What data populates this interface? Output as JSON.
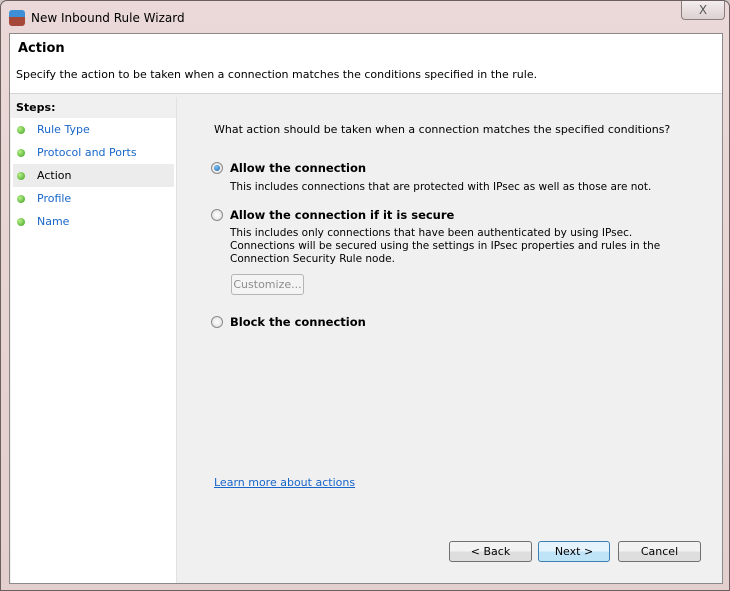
{
  "window": {
    "title": "New Inbound Rule Wizard",
    "close_label": "X"
  },
  "header": {
    "title": "Action",
    "description": "Specify the action to be taken when a connection matches the conditions specified in the rule."
  },
  "steps": {
    "heading": "Steps:",
    "items": [
      {
        "label": "Rule Type",
        "active": false
      },
      {
        "label": "Protocol and Ports",
        "active": false
      },
      {
        "label": "Action",
        "active": true
      },
      {
        "label": "Profile",
        "active": false
      },
      {
        "label": "Name",
        "active": false
      }
    ]
  },
  "main": {
    "question": "What action should be taken when a connection matches the specified conditions?",
    "options": [
      {
        "label": "Allow the connection",
        "description": "This includes connections that are protected with IPsec as well as those are not.",
        "selected": true
      },
      {
        "label": "Allow the connection if it is secure",
        "description": "This includes only connections that have been authenticated by using IPsec.  Connections will be secured using the settings in IPsec properties and rules in the Connection Security Rule node.",
        "selected": false
      },
      {
        "label": "Block the connection",
        "selected": false
      }
    ],
    "customize_label": "Customize...",
    "learn_more": "Learn more about actions"
  },
  "buttons": {
    "back": "< Back",
    "next": "Next >",
    "cancel": "Cancel"
  }
}
